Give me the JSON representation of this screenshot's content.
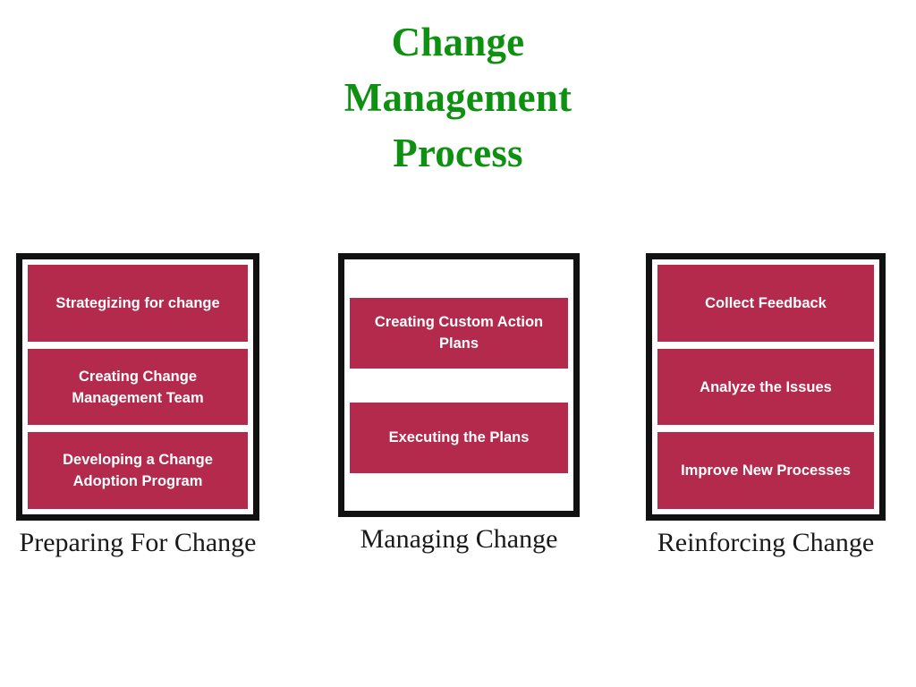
{
  "title": {
    "lines": [
      "Change",
      "Management",
      "Process"
    ],
    "color": "#0e9110"
  },
  "colors": {
    "accent_box": "#b32a4d",
    "frame": "#111111",
    "title_green": "#0e9110",
    "caption_text": "#1a1a1a",
    "box_text": "#ffffff",
    "background": "#ffffff"
  },
  "columns": [
    {
      "caption": "Preparing For Change",
      "steps": [
        {
          "label": "Strategizing for change"
        },
        {
          "label": "Creating Change Management Team"
        },
        {
          "label": "Developing a Change Adoption Program"
        }
      ]
    },
    {
      "caption": "Managing Change",
      "steps": [
        {
          "label": "Creating Custom Action Plans"
        },
        {
          "label": "Executing the Plans"
        }
      ]
    },
    {
      "caption": "Reinforcing Change",
      "steps": [
        {
          "label": "Collect Feedback"
        },
        {
          "label": "Analyze the Issues"
        },
        {
          "label": "Improve New Processes"
        }
      ]
    }
  ]
}
